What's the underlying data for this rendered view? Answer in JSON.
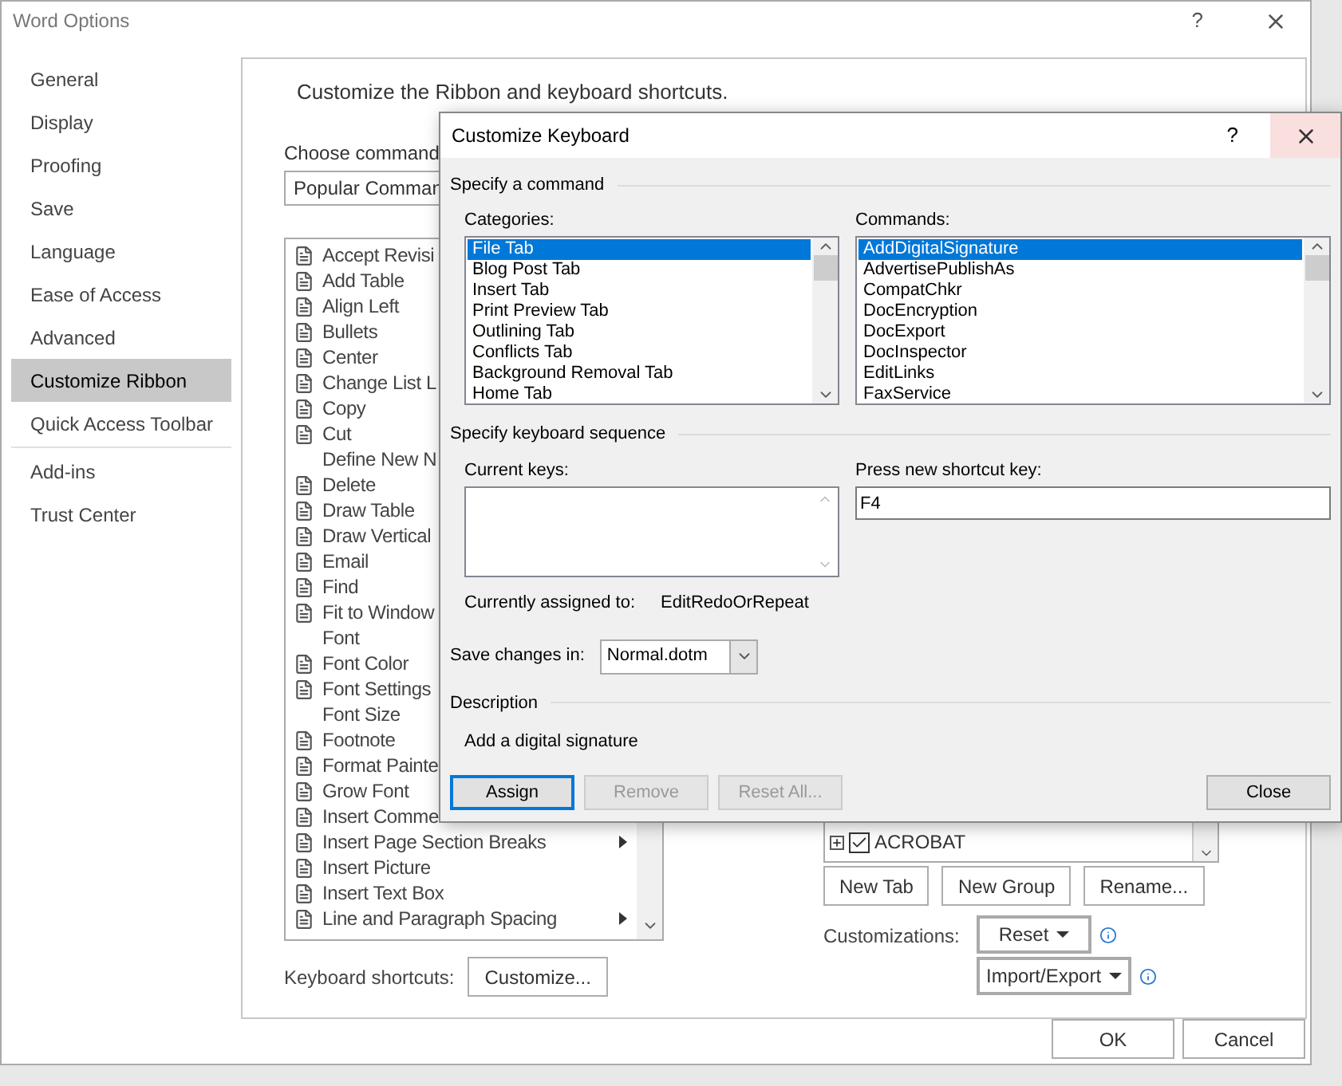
{
  "window": {
    "title": "Word Options",
    "help": "?"
  },
  "nav": [
    [
      {
        "label": "General",
        "selected": false
      },
      {
        "label": "Display",
        "selected": false
      },
      {
        "label": "Proofing",
        "selected": false
      },
      {
        "label": "Save",
        "selected": false
      },
      {
        "label": "Language",
        "selected": false
      },
      {
        "label": "Ease of Access",
        "selected": false
      },
      {
        "label": "Advanced",
        "selected": false
      },
      {
        "label": "Customize Ribbon",
        "selected": true
      },
      {
        "label": "Quick Access Toolbar",
        "selected": false
      }
    ],
    [
      {
        "label": "Add-ins",
        "selected": false
      },
      {
        "label": "Trust Center",
        "selected": false
      }
    ]
  ],
  "header": {
    "title": "Customize the Ribbon and keyboard shortcuts."
  },
  "choose_commands": {
    "label": "Choose command",
    "value": "Popular Comman"
  },
  "command_list": [
    {
      "label": "Accept Revisi",
      "icon": true
    },
    {
      "label": "Add Table",
      "icon": true
    },
    {
      "label": "Align Left",
      "icon": true
    },
    {
      "label": "Bullets",
      "icon": true
    },
    {
      "label": "Center",
      "icon": true
    },
    {
      "label": "Change List L",
      "icon": true
    },
    {
      "label": "Copy",
      "icon": true
    },
    {
      "label": "Cut",
      "icon": true
    },
    {
      "label": "Define New N",
      "icon": false
    },
    {
      "label": "Delete",
      "icon": true
    },
    {
      "label": "Draw Table",
      "icon": true
    },
    {
      "label": "Draw Vertical",
      "icon": true
    },
    {
      "label": "Email",
      "icon": true
    },
    {
      "label": "Find",
      "icon": true
    },
    {
      "label": "Fit to Window",
      "icon": true
    },
    {
      "label": "Font",
      "icon": false
    },
    {
      "label": "Font Color",
      "icon": true
    },
    {
      "label": "Font Settings",
      "icon": true
    },
    {
      "label": "Font Size",
      "icon": false
    },
    {
      "label": "Footnote",
      "icon": true
    },
    {
      "label": "Format Painte",
      "icon": true
    },
    {
      "label": "Grow Font",
      "icon": true
    },
    {
      "label": "Insert Comme",
      "icon": true
    },
    {
      "label": "Insert Page  Section Breaks",
      "icon": true,
      "submenu": true
    },
    {
      "label": "Insert Picture",
      "icon": true,
      "submenu": false
    },
    {
      "label": "Insert Text Box",
      "icon": true,
      "submenu": false
    },
    {
      "label": "Line and Paragraph Spacing",
      "icon": true,
      "submenu": true
    }
  ],
  "keyboard_shortcuts": {
    "label": "Keyboard shortcuts:",
    "button": "Customize..."
  },
  "ribbon_tree": [
    {
      "label": "ACROBAT",
      "checked": true,
      "expanded": false
    }
  ],
  "ribbon_buttons": [
    "New Tab",
    "New Group",
    "Rename..."
  ],
  "customizations": {
    "label": "Customizations:",
    "reset": "Reset",
    "import_export": "Import/Export"
  },
  "footer_buttons": [
    "OK",
    "Cancel"
  ],
  "dialog": {
    "title": "Customize Keyboard",
    "help": "?",
    "command_section": "Specify a command",
    "categories_label": "Categories:",
    "categories": [
      {
        "label": "File Tab",
        "selected": true
      },
      {
        "label": "Blog Post Tab",
        "selected": false
      },
      {
        "label": "Insert Tab",
        "selected": false
      },
      {
        "label": "Print Preview Tab",
        "selected": false
      },
      {
        "label": "Outlining Tab",
        "selected": false
      },
      {
        "label": "Conflicts Tab",
        "selected": false
      },
      {
        "label": "Background Removal Tab",
        "selected": false
      },
      {
        "label": "Home Tab",
        "selected": false
      }
    ],
    "commands_label": "Commands:",
    "commands": [
      {
        "label": "AddDigitalSignature",
        "selected": true
      },
      {
        "label": "AdvertisePublishAs",
        "selected": false
      },
      {
        "label": "CompatChkr",
        "selected": false
      },
      {
        "label": "DocEncryption",
        "selected": false
      },
      {
        "label": "DocExport",
        "selected": false
      },
      {
        "label": "DocInspector",
        "selected": false
      },
      {
        "label": "EditLinks",
        "selected": false
      },
      {
        "label": "FaxService",
        "selected": false
      }
    ],
    "keyboard_section": "Specify keyboard sequence",
    "current_keys_label": "Current keys:",
    "press_label": "Press new shortcut key:",
    "new_key": "F4",
    "assigned_label": "Currently assigned to:",
    "assigned_value": "EditRedoOrRepeat",
    "save_label": "Save changes in:",
    "save_value": "Normal.dotm",
    "description_section": "Description",
    "description": "Add a digital signature",
    "buttons": [
      {
        "label": "Assign",
        "default": true,
        "disabled": false
      },
      {
        "label": "Remove",
        "default": false,
        "disabled": true
      },
      {
        "label": "Reset All...",
        "default": false,
        "disabled": true
      }
    ],
    "close_button": "Close"
  }
}
